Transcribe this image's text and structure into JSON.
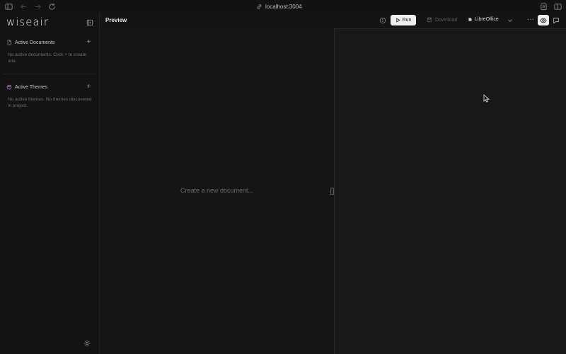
{
  "browser": {
    "url": "localhost:3004"
  },
  "sidebar": {
    "logo": "wiseair",
    "documents": {
      "heading": "Active Documents",
      "empty_text": "No active documents. Click + to create one."
    },
    "themes": {
      "heading": "Active Themes",
      "empty_text": "No active themes. No themes discovered in project."
    }
  },
  "toolbar": {
    "title": "Preview",
    "run_label": "Run",
    "download_label": "Download",
    "engine_label": "LibreOffice"
  },
  "editor": {
    "placeholder": "Create a new document..."
  },
  "colors": {
    "background": "#141414",
    "accent_button": "#efefef",
    "muted_text": "#6e6e6e"
  }
}
